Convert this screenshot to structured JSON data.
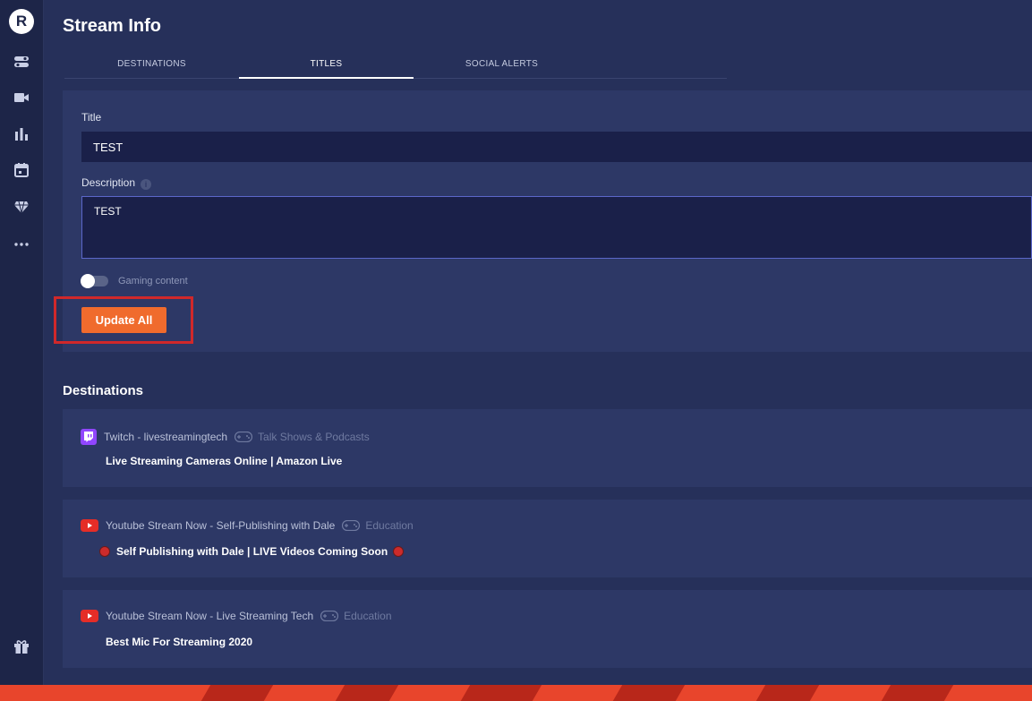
{
  "app": {
    "logo_letter": "R"
  },
  "rail": {
    "icons": [
      "toggle-icon",
      "camera-icon",
      "bar-chart-icon",
      "calendar-icon",
      "diamond-icon",
      "more-icon",
      "gift-icon"
    ]
  },
  "page_title": "Stream Info",
  "tabs": [
    {
      "label": "DESTINATIONS",
      "active": false
    },
    {
      "label": "TITLES",
      "active": true
    },
    {
      "label": "SOCIAL ALERTS",
      "active": false
    }
  ],
  "form": {
    "title_label": "Title",
    "title_value": "TEST",
    "description_label": "Description",
    "description_info": "i",
    "description_value": "TEST",
    "gaming_toggle_label": "Gaming content",
    "gaming_toggle_on": false,
    "update_button": "Update All"
  },
  "destinations_heading": "Destinations",
  "destinations": [
    {
      "platform": "twitch",
      "name": "Twitch - livestreamingtech",
      "category": "Talk Shows & Podcasts",
      "title": "Live Streaming Cameras Online | Amazon Live"
    },
    {
      "platform": "youtube",
      "name": "Youtube Stream Now - Self-Publishing with Dale",
      "category": "Education",
      "title": "Self Publishing with Dale | LIVE Videos Coming Soon"
    },
    {
      "platform": "youtube",
      "name": "Youtube Stream Now - Live Streaming Tech",
      "category": "Education",
      "title": "Best Mic For Streaming 2020"
    }
  ],
  "colors": {
    "accent": "#f06b2d",
    "background": "#26305a",
    "panel": "#2d3866",
    "input": "#1a2049",
    "highlight": "#d0282a",
    "twitch": "#9146ff",
    "youtube": "#e52d27"
  }
}
